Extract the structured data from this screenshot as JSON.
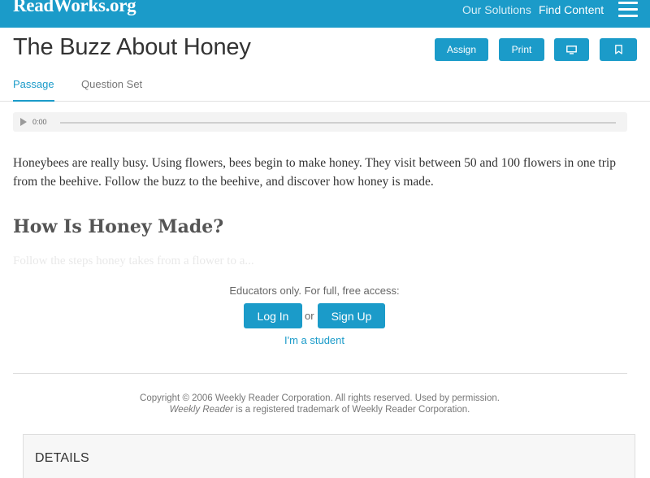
{
  "header": {
    "logo": "ReadWorks.org",
    "nav": {
      "solutions": "Our Solutions",
      "content": "Find Content"
    }
  },
  "article": {
    "title": "The Buzz About Honey",
    "buttons": {
      "assign": "Assign",
      "print": "Print"
    },
    "tabs": {
      "passage": "Passage",
      "questions": "Question Set"
    },
    "audio": {
      "time": "0:00"
    },
    "body": "Honeybees are really busy. Using flowers, bees begin to make honey. They visit between 50 and 100 flowers in one trip from the beehive. Follow the buzz to the beehive, and discover how honey is made.",
    "heading": "How Is Honey Made?",
    "preview": "Follow the steps honey takes from a flower to a..."
  },
  "access": {
    "prompt": "Educators only. For full, free access:",
    "login": "Log In",
    "or": "or",
    "signup": "Sign Up",
    "student": "I'm a student"
  },
  "footer": {
    "copyright": "Copyright © 2006 Weekly Reader Corporation. All rights reserved. Used by permission.",
    "trademark_name": "Weekly Reader",
    "trademark_rest": " is a registered trademark of Weekly Reader Corporation.",
    "details": "DETAILS"
  },
  "colors": {
    "brand": "#1b9bc9",
    "text": "#333333"
  },
  "icons": [
    "menu-icon",
    "monitor-icon",
    "bookmark-icon",
    "play-icon"
  ]
}
